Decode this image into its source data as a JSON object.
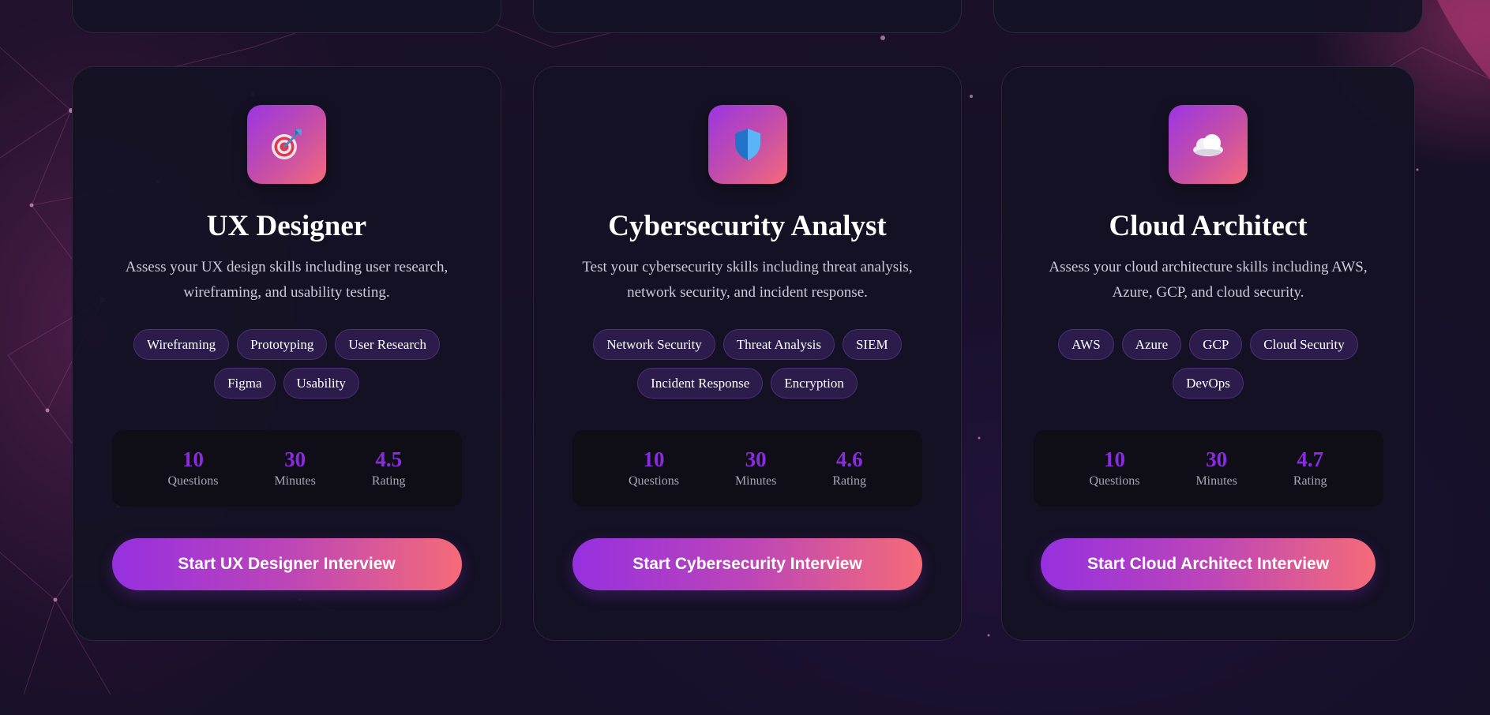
{
  "cards": [
    {
      "icon": "target-icon",
      "title": "UX Designer",
      "description": "Assess your UX design skills including user research, wireframing, and usability testing.",
      "tags": [
        "Wireframing",
        "Prototyping",
        "User Research",
        "Figma",
        "Usability"
      ],
      "stats": [
        {
          "value": "10",
          "label": "Questions"
        },
        {
          "value": "30",
          "label": "Minutes"
        },
        {
          "value": "4.5",
          "label": "Rating"
        }
      ],
      "button": "Start UX Designer Interview"
    },
    {
      "icon": "shield-icon",
      "title": "Cybersecurity Analyst",
      "description": "Test your cybersecurity skills including threat analysis, network security, and incident response.",
      "tags": [
        "Network Security",
        "Threat Analysis",
        "SIEM",
        "Incident Response",
        "Encryption"
      ],
      "stats": [
        {
          "value": "10",
          "label": "Questions"
        },
        {
          "value": "30",
          "label": "Minutes"
        },
        {
          "value": "4.6",
          "label": "Rating"
        }
      ],
      "button": "Start Cybersecurity Interview"
    },
    {
      "icon": "cloud-icon",
      "title": "Cloud Architect",
      "description": "Assess your cloud architecture skills including AWS, Azure, GCP, and cloud security.",
      "tags": [
        "AWS",
        "Azure",
        "GCP",
        "Cloud Security",
        "DevOps"
      ],
      "stats": [
        {
          "value": "10",
          "label": "Questions"
        },
        {
          "value": "30",
          "label": "Minutes"
        },
        {
          "value": "4.7",
          "label": "Rating"
        }
      ],
      "button": "Start Cloud Architect Interview"
    }
  ],
  "colors": {
    "accent": "#8a2be2",
    "gradient_start": "#9630e0",
    "gradient_end": "#f56b78",
    "card_bg": "#141224",
    "tag_bg": "#2c1c4b"
  }
}
